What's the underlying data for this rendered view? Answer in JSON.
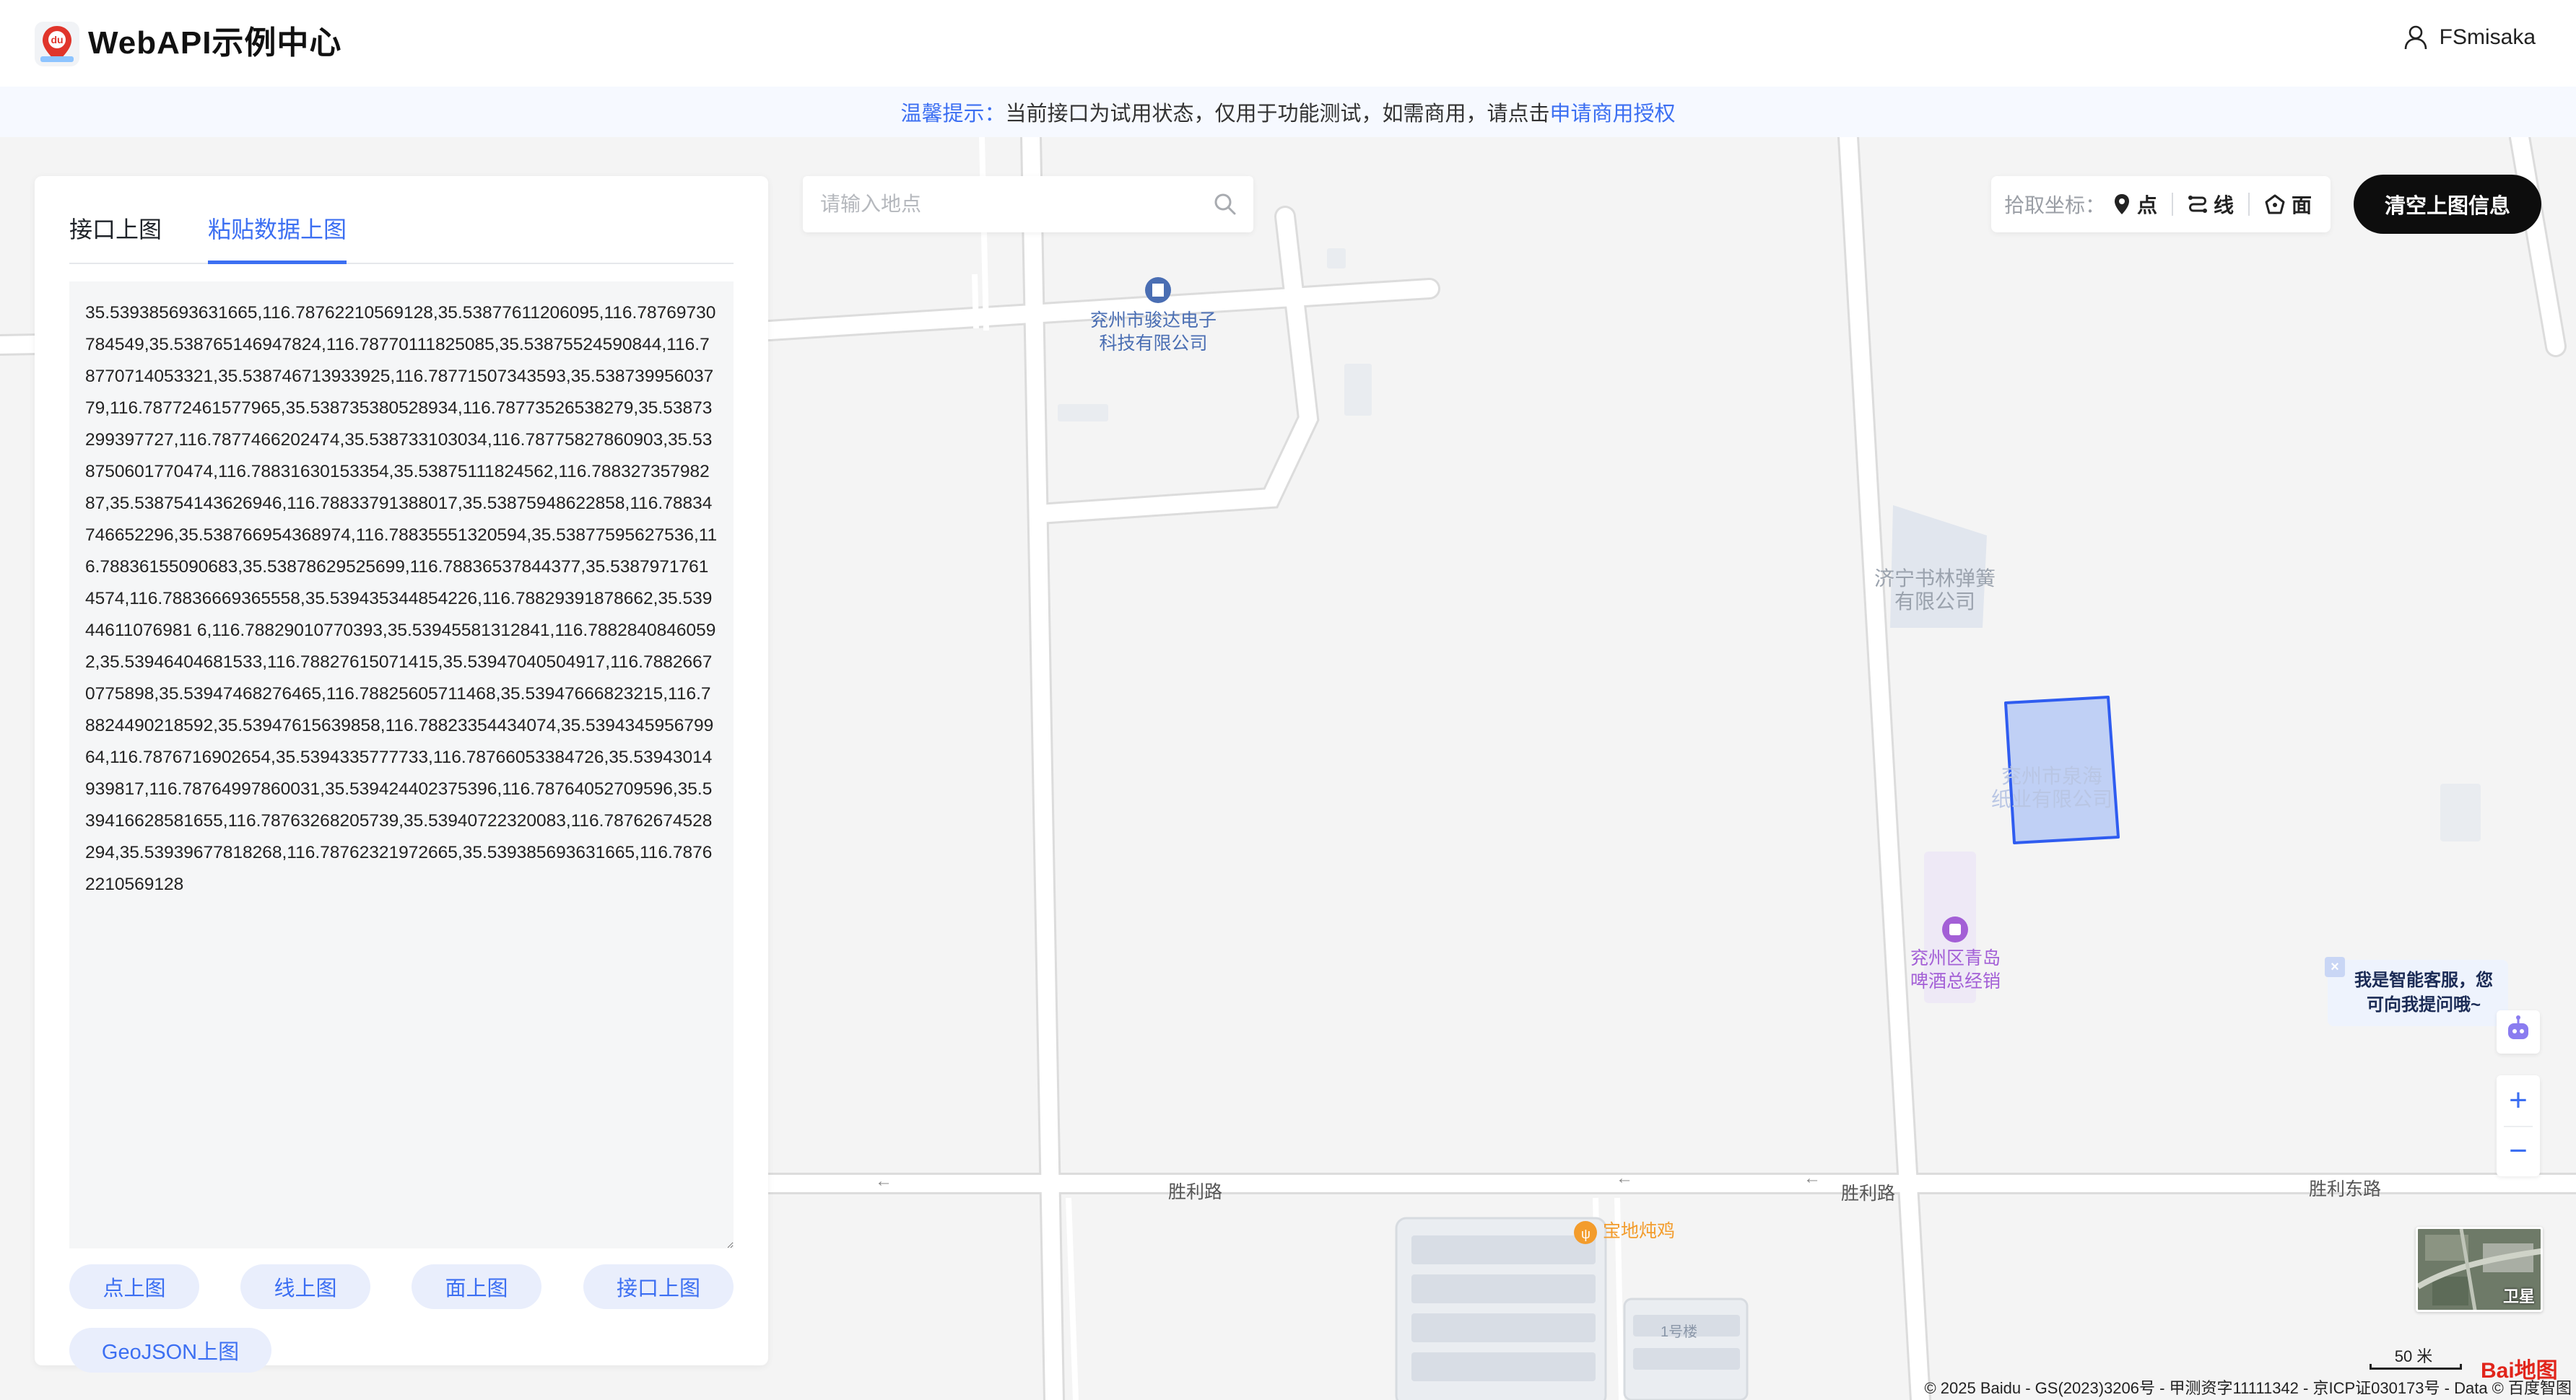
{
  "header": {
    "title": "WebAPI示例中心",
    "user": "FSmisaka",
    "logo_text": "du"
  },
  "notice": {
    "prefix": "温馨提示：",
    "text": "当前接口为试用状态，仅用于功能测试，如需商用，请点击",
    "link": "申请商用授权"
  },
  "panel": {
    "tabs": [
      {
        "label": "接口上图",
        "active": false
      },
      {
        "label": "粘贴数据上图",
        "active": true
      }
    ],
    "textarea_value": "35.539385693631665,116.78762210569128,35.53877611206095,116.78769730784549,35.538765146947824,116.78770111825085,35.53875524590844,116.78770714053321,35.538746713933925,116.78771507343593,35.53873995603779,116.78772461577965,35.538735380528934,116.78773526538279,35.53873299397727,116.7877466202474,35.538733103034,116.78775827860903,35.538750601770474,116.78831630153354,35.53875111824562,116.78832735798287,35.538754143626946,116.78833791388017,35.53875948622858,116.78834746652296,35.538766954368974,116.78835551320594,35.53877595627536,116.78836155090683,35.53878629525699,116.78836537844377,35.53879717614574,116.78836669365558,35.539435344854226,116.78829391878662,35.53944611076981 6,116.78829010770393,35.53945581312841,116.78828408460592,35.53946404681533,116.78827615071415,35.53947040504917,116.78826670775898,35.53947468276465,116.78825605711468,35.53947666823215,116.78824490218592,35.53947615639858,116.78823354434074,35.539434595679964,116.7876716902654,35.5394335777733,116.78766053384726,35.53943014939817,116.78764997860031,35.539424402375396,116.78764052709596,35.539416628581655,116.78763268205739,35.53940722320083,116.78762674528294,35.53939677818268,116.78762321972665,35.539385693631665,116.78762210569128",
    "buttons": {
      "point": "点上图",
      "line": "线上图",
      "polygon": "面上图",
      "api": "接口上图",
      "geojson": "GeoJSON上图"
    }
  },
  "map": {
    "search_placeholder": "请输入地点",
    "picker": {
      "label": "拾取坐标：",
      "point": "点",
      "line": "线",
      "polygon": "面"
    },
    "clear_button": "清空上图信息",
    "labels": {
      "poi1": "兖州市骏达电子\n科技有限公司",
      "poi2": "济宁书林弹簧\n有限公司",
      "poi3": "兖州市泉海\n纸业有限公司",
      "poi4": "兖州区青岛\n啤酒总经销",
      "road1": "胜利路",
      "road2": "胜利路",
      "road3": "胜利东路",
      "poi5": "宝地炖鸡",
      "bldg": "1号楼"
    },
    "assistant": "我是智能客服，您可向我提问哦~",
    "satellite_label": "卫星",
    "scale": "50 米",
    "baidu_logo": "Bai地图",
    "copyright": "© 2025 Baidu - GS(2023)3206号 - 甲测资字11111342 - 京ICP证030173号 - Data © 百度智图"
  },
  "colors": {
    "accent": "#3c6ff2",
    "polygon_fill": "#b6c9f5",
    "polygon_stroke": "#2f5cf0",
    "poi_blue": "#4a6eb3",
    "poi_purple": "#a35fd6",
    "poi_orange": "#f39c2c"
  }
}
